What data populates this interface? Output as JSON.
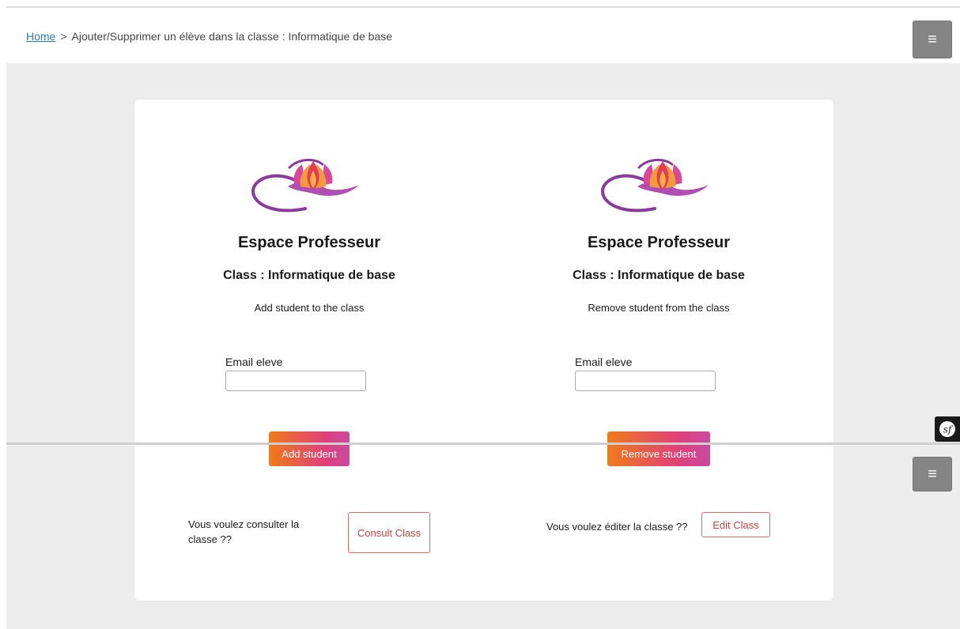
{
  "breadcrumb": {
    "home": "Home",
    "separator": ">",
    "current": "Ajouter/Supprimer un élève dans la classe : Informatique de base"
  },
  "menu": {
    "icon": "≡"
  },
  "add_section": {
    "title": "Espace Professeur",
    "class_label": "Class : Informatique de base",
    "action": "Add student to the class",
    "field_label": "Email eleve",
    "field_value": "",
    "button": "Add student"
  },
  "remove_section": {
    "title": "Espace Professeur",
    "class_label": "Class : Informatique de base",
    "action": "Remove student from the class",
    "field_label": "Email eleve",
    "field_value": "",
    "button": "Remove student"
  },
  "consult": {
    "question": "Vous voulez consulter la classe ??",
    "button": "Consult Class"
  },
  "edit": {
    "question": "Vous voulez éditer la classe ??",
    "button": "Edit Class"
  },
  "colors": {
    "gradient_start": "#f07a1a",
    "gradient_end": "#c94aa0",
    "outline_button": "#c64545",
    "link": "#2a7ab0"
  },
  "icons": [
    "lotus-logo-icon",
    "hamburger-menu-icon",
    "symfony-icon"
  ]
}
